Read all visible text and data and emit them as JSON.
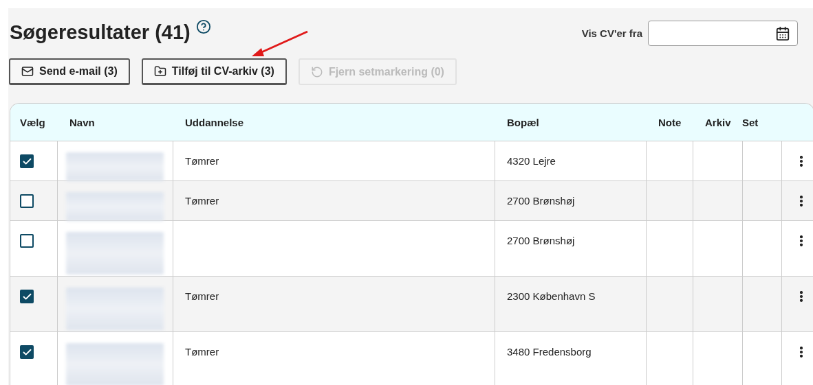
{
  "title": "Søgeresultater (41)",
  "date_filter": {
    "label": "Vis CV'er fra"
  },
  "buttons": [
    {
      "label": "Send e-mail (3)",
      "kind": "mail",
      "disabled": false
    },
    {
      "label": "Tilføj til CV-arkiv (3)",
      "kind": "folder",
      "disabled": false
    },
    {
      "label": "Fjern setmarkering (0)",
      "kind": "undo",
      "disabled": true
    }
  ],
  "table": {
    "columns": [
      "Vælg",
      "Navn",
      "Uddannelse",
      "Bopæl",
      "Note",
      "Arkiv",
      "Set"
    ],
    "rows": [
      {
        "checked": true,
        "education": "Tømrer",
        "residence": "4320 Lejre"
      },
      {
        "checked": false,
        "education": "Tømrer",
        "residence": "2700 Brønshøj"
      },
      {
        "checked": false,
        "residence": "2700 Brønshøj"
      },
      {
        "checked": true,
        "education": "Tømrer",
        "residence": "2300 København S"
      },
      {
        "checked": true,
        "education": "Tømrer",
        "residence": "3480 Fredensborg"
      }
    ]
  }
}
